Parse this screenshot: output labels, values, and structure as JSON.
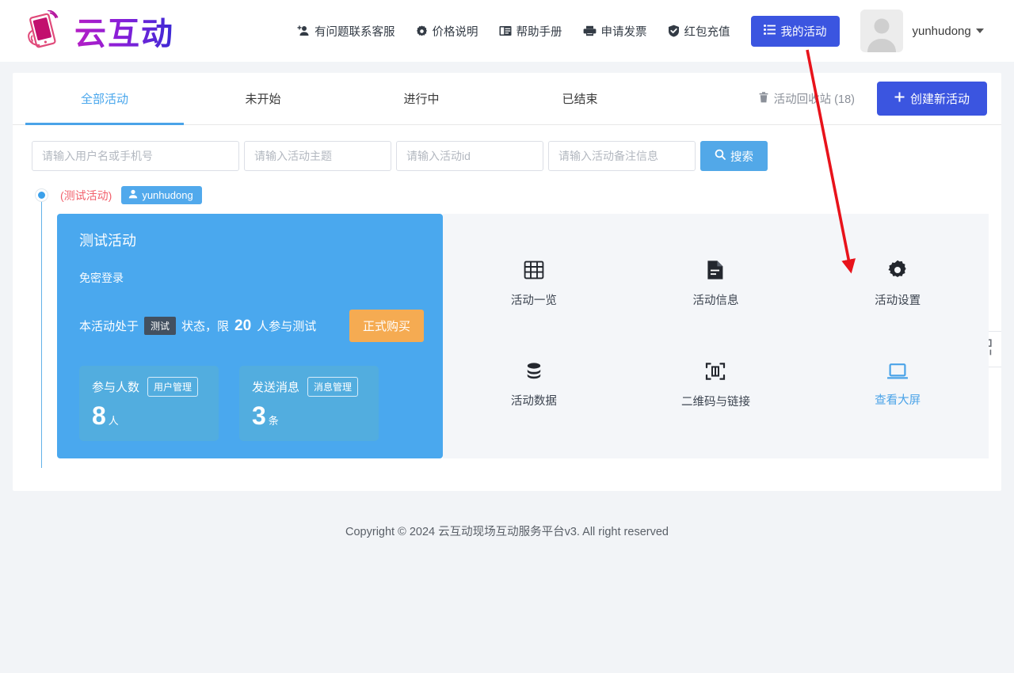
{
  "header": {
    "logo_text": "云互动",
    "logo_icon": "hand-holding-phone-icon",
    "nav": [
      {
        "label": "有问题联系客服",
        "icon": "user-plus-icon"
      },
      {
        "label": "价格说明",
        "icon": "gear-alt-icon"
      },
      {
        "label": "帮助手册",
        "icon": "book-icon"
      },
      {
        "label": "申请发票",
        "icon": "printer-icon"
      },
      {
        "label": "红包充值",
        "icon": "shield-check-icon"
      }
    ],
    "my_activity_button": {
      "label": "我的活动",
      "icon": "list-icon",
      "color": "#3b55e0"
    },
    "user": {
      "name": "yunhudong",
      "avatar_icon": "user-avatar-placeholder",
      "caret_icon": "chevron-down-icon"
    }
  },
  "tabs": [
    {
      "label": "全部活动",
      "active": true
    },
    {
      "label": "未开始",
      "active": false
    },
    {
      "label": "进行中",
      "active": false
    },
    {
      "label": "已结束",
      "active": false
    }
  ],
  "tabs_right": {
    "recycle_bin": {
      "label": "活动回收站 (18)",
      "icon": "trash-icon"
    },
    "create_button": {
      "label": "创建新活动",
      "icon": "plus-icon",
      "color": "#3b55e0"
    }
  },
  "filters": {
    "inputs": [
      {
        "name": "user-or-phone",
        "placeholder": "请输入用户名或手机号",
        "value": ""
      },
      {
        "name": "activity-title",
        "placeholder": "请输入活动主题",
        "value": ""
      },
      {
        "name": "activity-id",
        "placeholder": "请输入活动id",
        "value": ""
      },
      {
        "name": "activity-remark",
        "placeholder": "请输入活动备注信息",
        "value": ""
      }
    ],
    "search_button": {
      "label": "搜索",
      "icon": "search-icon",
      "color": "#52a8e8"
    }
  },
  "activity": {
    "test_tag": "(测试活动)",
    "owner_badge": {
      "label": "yunhudong",
      "icon": "user-icon"
    },
    "title": "测试活动",
    "subtitle": "免密登录",
    "status_prefix": "本活动处于",
    "status_pill": "测试",
    "status_mid": "状态，限",
    "status_limit": "20",
    "status_suffix": "人参与测试",
    "buy_button": {
      "label": "正式购买",
      "color": "#f5ab52"
    },
    "stats": [
      {
        "name": "参与人数",
        "action": "用户管理",
        "value": "8",
        "unit": "人"
      },
      {
        "name": "发送消息",
        "action": "消息管理",
        "value": "3",
        "unit": "条"
      }
    ],
    "tools": [
      {
        "label": "活动一览",
        "icon": "grid-table-icon",
        "highlight": false
      },
      {
        "label": "活动信息",
        "icon": "document-icon",
        "highlight": false
      },
      {
        "label": "活动设置",
        "icon": "gear-icon",
        "highlight": false
      },
      {
        "label": "活动数据",
        "icon": "database-icon",
        "highlight": false
      },
      {
        "label": "二维码与链接",
        "icon": "qrcode-scan-icon",
        "highlight": false
      },
      {
        "label": "查看大屏",
        "icon": "monitor-icon",
        "highlight": true
      }
    ]
  },
  "side_tab": {
    "icon": "qrcode-icon"
  },
  "footer": {
    "text": "Copyright © 2024 云互动现场互动服务平台v3. All right reserved"
  },
  "annotation": {
    "arrow_color": "#e8131b",
    "points_at": "活动设置"
  },
  "colors": {
    "brand_blue": "#3b55e0",
    "card_blue": "#4aa8ee",
    "accent_blue": "#4aa3e8",
    "orange": "#f5ab52",
    "red_tag": "#f2606c",
    "page_bg": "#f2f4f7"
  }
}
